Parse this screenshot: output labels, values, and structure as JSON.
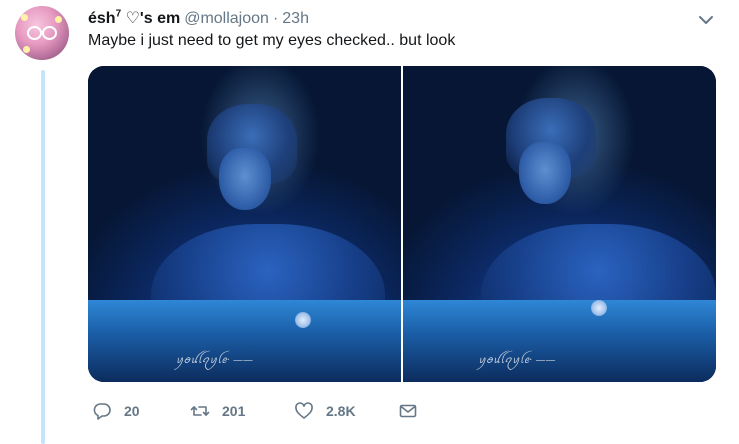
{
  "tweet": {
    "display_name": "ésh",
    "name_sup": "7",
    "name_suffix": " ♡'s em",
    "handle": "@mollajoon",
    "separator": "·",
    "time": "23h",
    "text": "Maybe i just need to get my eyes checked.. but look"
  },
  "media": {
    "photos": [
      {
        "alt": "photo-left",
        "watermark": "ꪗꪮꪊꪶꪖꪗꪶꫀ· ——"
      },
      {
        "alt": "photo-right",
        "watermark": "ꪗꪮꪊꪶꪖꪗꪶꫀ· ——"
      }
    ]
  },
  "actions": {
    "reply_count": "20",
    "retweet_count": "201",
    "like_count": "2.8K"
  },
  "icons": {
    "menu": "chevron-down-icon",
    "reply": "reply-icon",
    "retweet": "retweet-icon",
    "like": "heart-icon",
    "dm": "envelope-icon"
  },
  "colors": {
    "text": "#14171a",
    "secondary": "#657786",
    "thread_line": "#c4e4fb"
  }
}
